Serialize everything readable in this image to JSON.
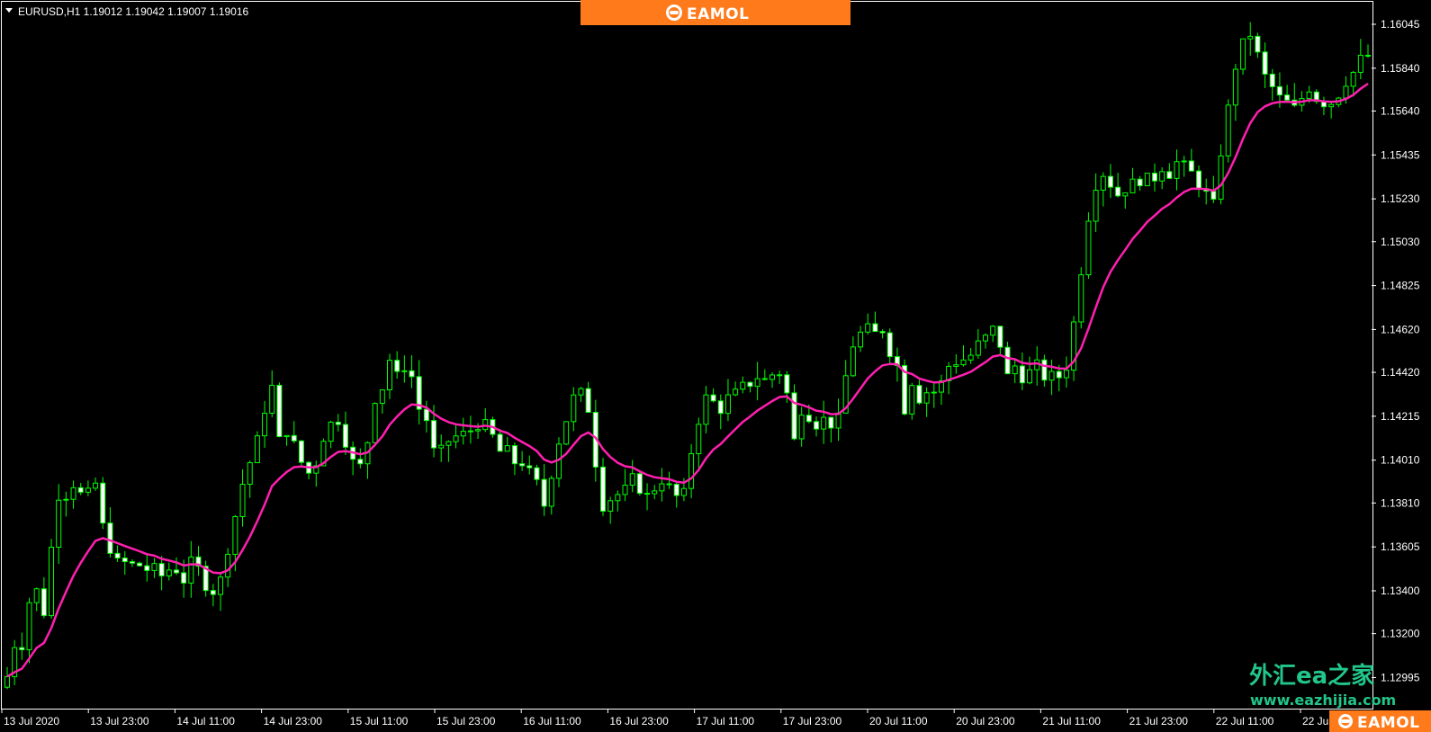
{
  "header": {
    "symbol_line": "EURUSD,H1  1.19012 1.19042 1.19007 1.19016"
  },
  "branding": {
    "top_logo": "EAMOL",
    "bottom_logo": "EAMOL",
    "watermark_cn": "外汇ea之家",
    "watermark_url": "www.eazhijia.com"
  },
  "colors": {
    "background": "#000000",
    "bull_candle": "#00ff00",
    "bear_candle": "#ffffff",
    "moving_average": "#ff1fb0",
    "brand_bar": "#ff7a1a",
    "watermark": "#22c58a"
  },
  "chart_data": {
    "type": "candlestick",
    "ylim": [
      1.1285,
      1.1615
    ],
    "y_ticks": [
      "1.16045",
      "1.15840",
      "1.15640",
      "1.15435",
      "1.15230",
      "1.15030",
      "1.14825",
      "1.14620",
      "1.14420",
      "1.14215",
      "1.14010",
      "1.13810",
      "1.13605",
      "1.13400",
      "1.13200",
      "1.12995"
    ],
    "x_ticks": [
      "13 Jul 2020",
      "13 Jul 23:00",
      "14 Jul 11:00",
      "14 Jul 23:00",
      "15 Jul 11:00",
      "15 Jul 23:00",
      "16 Jul 11:00",
      "16 Jul 23:00",
      "17 Jul 11:00",
      "17 Jul 23:00",
      "20 Jul 11:00",
      "20 Jul 23:00",
      "21 Jul 11:00",
      "21 Jul 23:00",
      "22 Jul 11:00",
      "22 Jul"
    ],
    "close_path": [
      1.13,
      1.1315,
      1.1315,
      1.1335,
      1.134,
      1.133,
      1.136,
      1.1385,
      1.1385,
      1.139,
      1.1385,
      1.1385,
      1.139,
      1.137,
      1.136,
      1.1353,
      1.1353,
      1.1352,
      1.1352,
      1.135,
      1.135,
      1.1347,
      1.135,
      1.135,
      1.1345,
      1.1353,
      1.135,
      1.1343,
      1.134,
      1.1345,
      1.136,
      1.1375,
      1.139,
      1.14,
      1.141,
      1.1425,
      1.1435,
      1.141,
      1.1415,
      1.1408,
      1.14,
      1.1395,
      1.14,
      1.1412,
      1.1418,
      1.142,
      1.141,
      1.14,
      1.1398,
      1.141,
      1.143,
      1.1435,
      1.1448,
      1.144,
      1.1445,
      1.144,
      1.1425,
      1.142,
      1.1405,
      1.1405,
      1.141,
      1.1412,
      1.1413,
      1.1415,
      1.1418,
      1.1417,
      1.1412,
      1.1405,
      1.1405,
      1.14,
      1.14,
      1.1395,
      1.139,
      1.138,
      1.1395,
      1.141,
      1.142,
      1.143,
      1.1432,
      1.1425,
      1.14,
      1.138,
      1.1383,
      1.1385,
      1.1387,
      1.1392,
      1.1388,
      1.1384,
      1.1388,
      1.1392,
      1.1388,
      1.1384,
      1.1385,
      1.1405,
      1.142,
      1.143,
      1.1428,
      1.1425,
      1.143,
      1.1432,
      1.1435,
      1.1437,
      1.144,
      1.1438,
      1.1441,
      1.1442,
      1.1432,
      1.141,
      1.1425,
      1.1422,
      1.1418,
      1.142,
      1.1418,
      1.142,
      1.144,
      1.1455,
      1.146,
      1.1462,
      1.146,
      1.1462,
      1.1452,
      1.1445,
      1.1425,
      1.1438,
      1.143,
      1.1433,
      1.1433,
      1.1437,
      1.1445,
      1.1447,
      1.1448,
      1.145,
      1.1455,
      1.1458,
      1.1462,
      1.1455,
      1.144,
      1.1445,
      1.144,
      1.1442,
      1.1445,
      1.144,
      1.144,
      1.144,
      1.1445,
      1.1465,
      1.149,
      1.1515,
      1.153,
      1.1535,
      1.153,
      1.1525,
      1.1528,
      1.153,
      1.1532,
      1.1532,
      1.1533,
      1.1538,
      1.1535,
      1.154,
      1.1538,
      1.1535,
      1.153,
      1.1525,
      1.152,
      1.1545,
      1.1565,
      1.1585,
      1.1595,
      1.16,
      1.159,
      1.158,
      1.1575,
      1.157,
      1.1568,
      1.1565,
      1.157,
      1.1575,
      1.157,
      1.1568,
      1.1568,
      1.1572,
      1.1578,
      1.1582,
      1.1588,
      1.159
    ]
  }
}
